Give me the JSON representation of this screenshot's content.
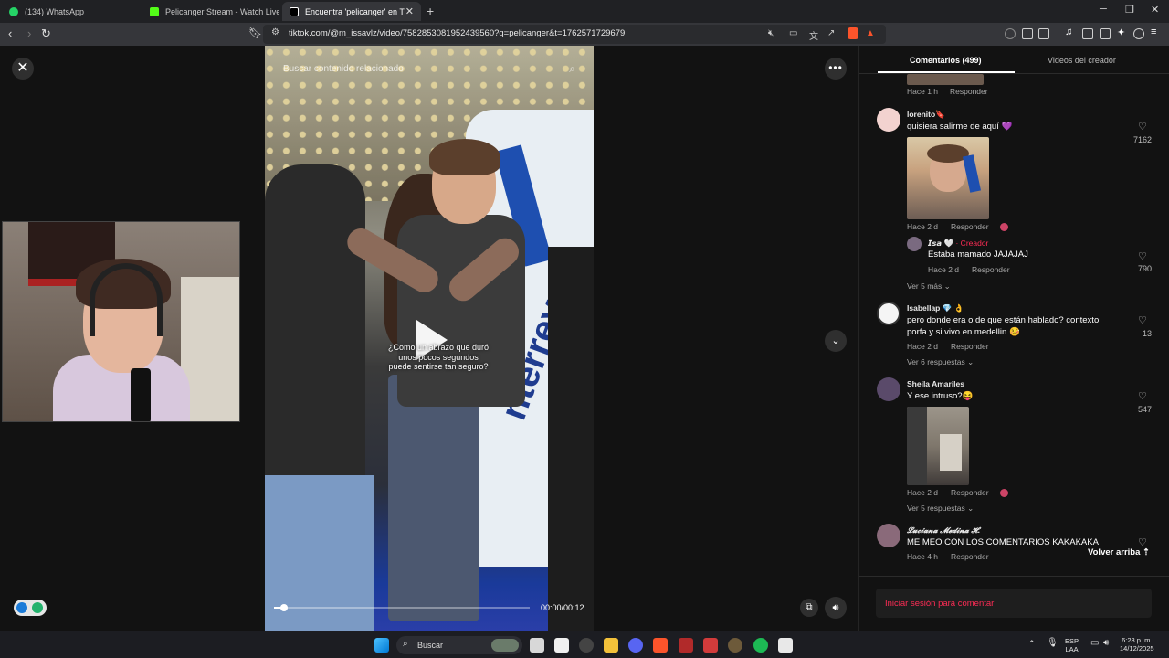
{
  "browser": {
    "tabs": [
      {
        "title": "(134) WhatsApp",
        "favicon_color": "#25d366"
      },
      {
        "title": "Pelicanger Stream - Watch Live on Ki",
        "favicon_color": "#53fc18"
      },
      {
        "title": "Encuentra 'pelicanger' en TikTok",
        "favicon_color": "#000000"
      }
    ],
    "new_tab": "+",
    "url": "tiktok.com/@m_issavlz/video/7582853081952439560?q=pelicanger&t=1762571729679"
  },
  "video": {
    "search_placeholder": "Buscar contenido relacionado",
    "caption_line1": "¿Como un abrazo que duró",
    "caption_line2": "unos pocos segundos",
    "caption_line3": "puede sentirse tan seguro?",
    "sign_text": "nterrey",
    "time": "00:00/00:12",
    "progress": 0.04
  },
  "comments_panel": {
    "tab_comments": "Comentarios (499)",
    "tab_videos": "Videos del creador",
    "top_partial": {
      "meta": "Hace 1 h",
      "reply": "Responder"
    },
    "comments": [
      {
        "user": "lorenito🔖",
        "text": "quisiera salirme de aquí 💜",
        "likes": "7162",
        "meta": "Hace 2 d",
        "reply": "Responder",
        "sub": {
          "user": "𝙄𝙨𝙖 🤍",
          "badge": "· Creador",
          "text": "Estaba mamado JAJAJAJ",
          "likes": "790",
          "meta": "Hace 2 d",
          "reply": "Responder"
        },
        "more": "Ver 5 más ⌄"
      },
      {
        "user": "Isabellap 💎 👌",
        "text1": "pero donde era o de que están hablado? contexto",
        "text2": "porfa y si vivo en medellin 🤒",
        "likes": "13",
        "meta": "Hace 2 d",
        "reply": "Responder",
        "more": "Ver 6 respuestas ⌄"
      },
      {
        "user": "Sheila Amariles",
        "text": "Y ese intruso?😝",
        "likes": "547",
        "meta": "Hace 2 d",
        "reply": "Responder",
        "more": "Ver 5 respuestas ⌄"
      },
      {
        "user": "𝓛𝓾𝓬𝓲𝓪𝓷𝓪 𝓜𝓮𝓭𝓲𝓷𝓪 𝓗.",
        "text": "ME MEO CON LOS COMENTARIOS KAKAKAKA ",
        "meta": "Hace 4 h",
        "reply": "Responder"
      }
    ],
    "back_to_top": "Volver arriba ⇡",
    "login_prompt": "Iniciar sesión para comentar"
  },
  "taskbar": {
    "search_label": "Buscar",
    "lang1": "ESP",
    "lang2": "LAA",
    "time": "6:28 p. m.",
    "date": "14/12/2025"
  },
  "colors": {
    "accent": "#fe2c55",
    "panel_bg": "#121212"
  }
}
